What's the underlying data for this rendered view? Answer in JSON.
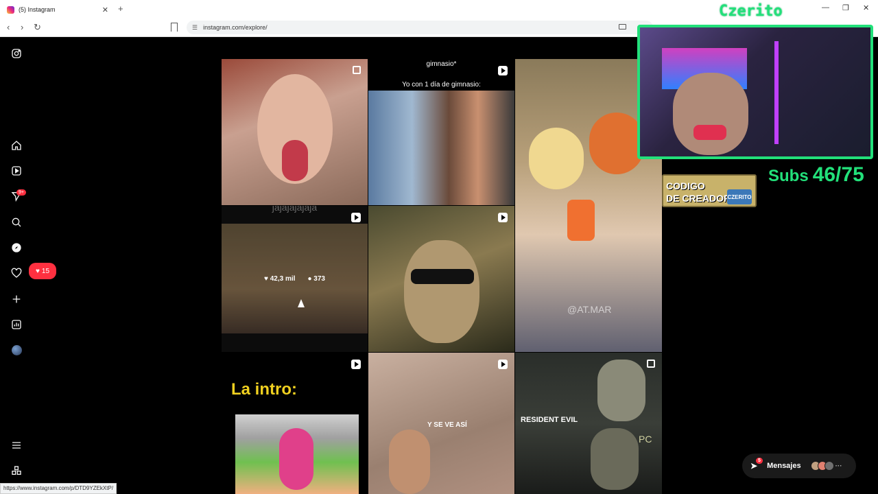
{
  "browser": {
    "tab_title": "(5) Instagram",
    "tab_close": "✕",
    "new_tab": "+",
    "url": "instagram.com/explore/",
    "status_url": "https://www.instagram.com/p/DTD9YZEkXtP/",
    "window_controls": [
      "—",
      "❐",
      "✕"
    ],
    "nav": [
      "‹",
      "›",
      "↻"
    ]
  },
  "sidebar": {
    "notifications_badge": "9+",
    "activity_pill_count": "15"
  },
  "grid": {
    "cells": [
      {
        "id": "selfie-tongue",
        "type": "multi",
        "bg": "#8a5a4a",
        "caption": ""
      },
      {
        "id": "gym-meme",
        "type": "video",
        "bg": "#6b4a3a",
        "caption_top": "gimnasio*",
        "caption": "Yo con 1 día de gimnasio:"
      },
      {
        "id": "cosplay",
        "type": "none",
        "bg": "#b89a7a",
        "caption": "@AT.MAR"
      },
      {
        "id": "dragonball",
        "type": "video",
        "bg": "#5a4a3a",
        "caption_top": "jajajajajaja",
        "likes": "42,3 mil",
        "comments": "373"
      },
      {
        "id": "wesker",
        "type": "video",
        "bg": "#3a3a2a",
        "caption": ""
      },
      {
        "id": "la-intro",
        "type": "video",
        "bg": "#000000",
        "caption": "La intro:"
      },
      {
        "id": "y-se-ve-asi",
        "type": "video",
        "bg": "#9a8a7a",
        "caption": "Y SE VE ASÍ"
      },
      {
        "id": "resident-evil",
        "type": "multi",
        "bg": "#2a2e2a",
        "caption": "RESIDENT EVIL",
        "corner": "PC"
      }
    ]
  },
  "messages": {
    "label": "Mensajes",
    "badge": "5"
  },
  "overlay": {
    "streamer_name": "Czerito",
    "subs_label": "Subs",
    "subs_value": "46/75",
    "creator_code_line1": "CODIGO",
    "creator_code_line2": "DE CREADOR",
    "creator_tag": "CZERITO"
  },
  "colors": {
    "accent_green": "#22e07a",
    "notification_red": "#ff3040"
  }
}
